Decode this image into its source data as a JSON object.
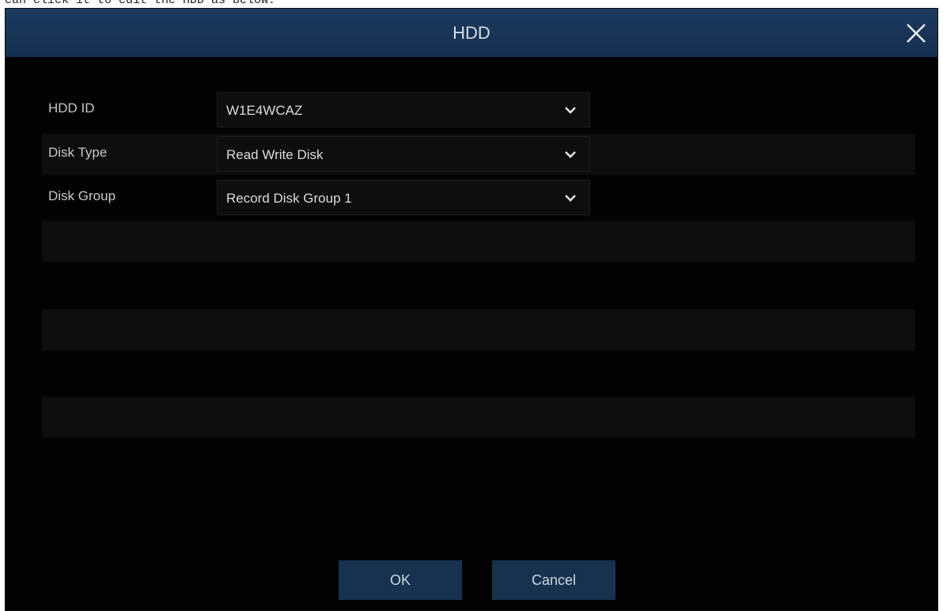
{
  "page": {
    "caption": "can click it to edit the HDD as below:"
  },
  "dialog": {
    "title": "HDD",
    "fields": [
      {
        "label": "HDD ID",
        "value": "W1E4WCAZ"
      },
      {
        "label": "Disk Type",
        "value": "Read Write Disk"
      },
      {
        "label": "Disk Group",
        "value": "Record Disk Group 1"
      }
    ],
    "buttons": {
      "ok_label": "OK",
      "cancel_label": "Cancel"
    },
    "icons": {
      "close": "close-icon",
      "dropdown": "chevron-down-icon"
    },
    "colors": {
      "titlebar": "#173556",
      "background": "#020202",
      "button": "#16324f",
      "band": "#0d0d0d"
    }
  }
}
